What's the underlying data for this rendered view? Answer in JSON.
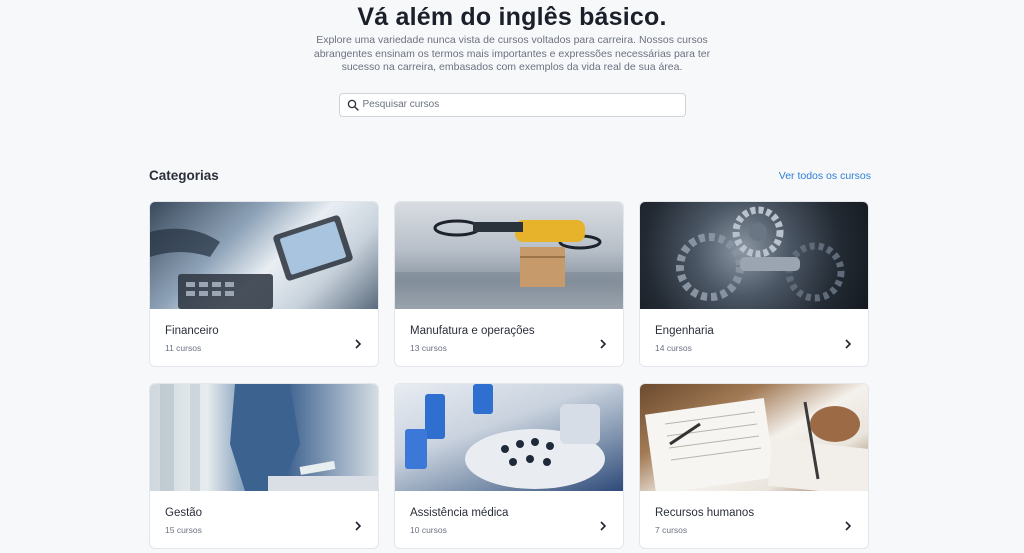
{
  "hero": {
    "title": "Vá além do inglês básico.",
    "description": "Explore uma variedade nunca vista de cursos voltados para carreira. Nossos cursos abrangentes ensinam os termos mais importantes e expressões necessárias para ter sucesso na carreira, embasados com exemplos da vida real de sua área.",
    "search_placeholder": "Pesquisar cursos"
  },
  "categories": {
    "title": "Categorias",
    "view_all": "Ver todos os cursos",
    "items": [
      {
        "name": "Financeiro",
        "count": "11 cursos"
      },
      {
        "name": "Manufatura e operações",
        "count": "13 cursos"
      },
      {
        "name": "Engenharia",
        "count": "14 cursos"
      },
      {
        "name": "Gestão",
        "count": "15 cursos"
      },
      {
        "name": "Assistência médica",
        "count": "10 cursos"
      },
      {
        "name": "Recursos humanos",
        "count": "7 cursos"
      }
    ]
  },
  "colors": {
    "accent_link": "#2f80d6",
    "text_dark": "#1b1f2a",
    "text_muted": "#6b7280"
  }
}
